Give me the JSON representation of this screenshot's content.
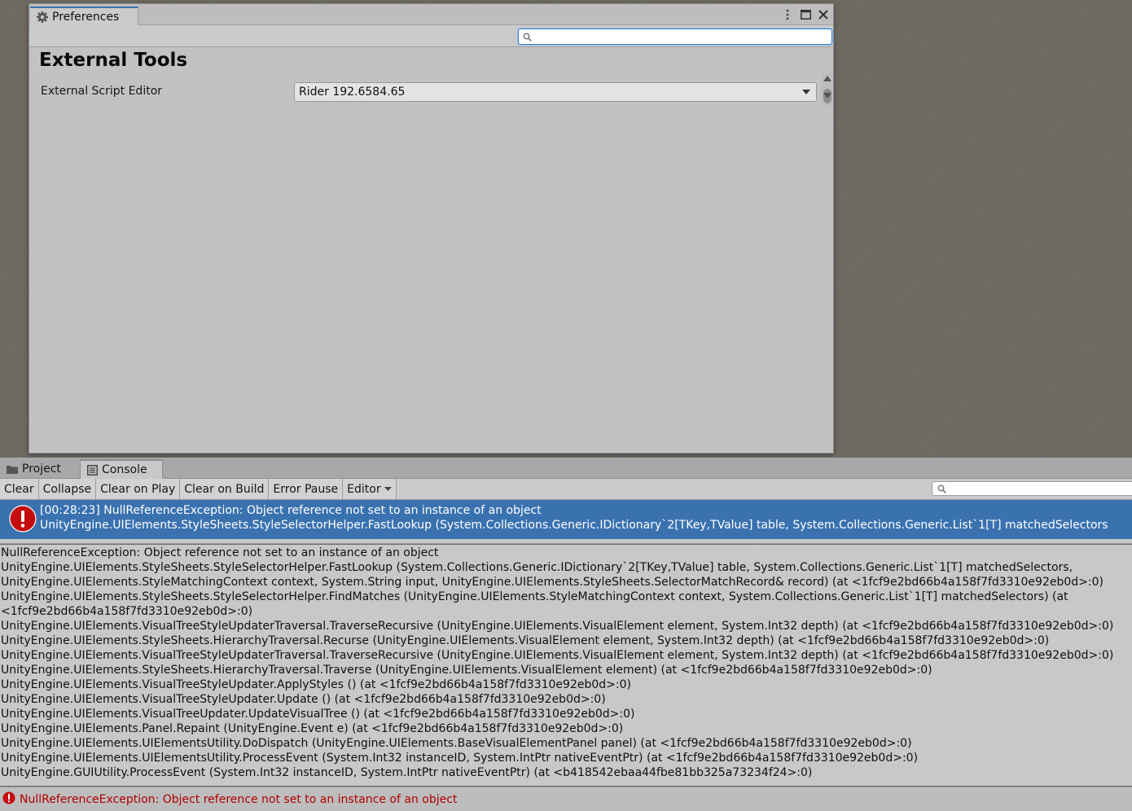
{
  "preferences": {
    "tab_label": "Preferences",
    "search_placeholder": "",
    "heading": "External Tools",
    "external_script_editor_label": "External Script Editor",
    "external_script_editor_value": "Rider 192.6584.65"
  },
  "bottom_panel": {
    "tabs": [
      {
        "label": "Project",
        "icon": "folder-icon"
      },
      {
        "label": "Console",
        "icon": "console-icon"
      }
    ]
  },
  "console_toolbar": {
    "clear": "Clear",
    "collapse": "Collapse",
    "clear_on_play": "Clear on Play",
    "clear_on_build": "Clear on Build",
    "error_pause": "Error Pause",
    "editor": "Editor",
    "search_placeholder": ""
  },
  "log_entry": {
    "line1": "[00:28:23] NullReferenceException: Object reference not set to an instance of an object",
    "line2": "UnityEngine.UIElements.StyleSheets.StyleSelectorHelper.FastLookup (System.Collections.Generic.IDictionary`2[TKey,TValue] table, System.Collections.Generic.List`1[T] matchedSelectors"
  },
  "details": [
    "NullReferenceException: Object reference not set to an instance of an object",
    "UnityEngine.UIElements.StyleSheets.StyleSelectorHelper.FastLookup (System.Collections.Generic.IDictionary`2[TKey,TValue] table, System.Collections.Generic.List`1[T] matchedSelectors,",
    "UnityEngine.UIElements.StyleMatchingContext context, System.String input, UnityEngine.UIElements.StyleSheets.SelectorMatchRecord& record) (at <1fcf9e2bd66b4a158f7fd3310e92eb0d>:0)",
    "UnityEngine.UIElements.StyleSheets.StyleSelectorHelper.FindMatches (UnityEngine.UIElements.StyleMatchingContext context, System.Collections.Generic.List`1[T] matchedSelectors) (at",
    "<1fcf9e2bd66b4a158f7fd3310e92eb0d>:0)",
    "UnityEngine.UIElements.VisualTreeStyleUpdaterTraversal.TraverseRecursive (UnityEngine.UIElements.VisualElement element, System.Int32 depth) (at <1fcf9e2bd66b4a158f7fd3310e92eb0d>:0)",
    "UnityEngine.UIElements.StyleSheets.HierarchyTraversal.Recurse (UnityEngine.UIElements.VisualElement element, System.Int32 depth) (at <1fcf9e2bd66b4a158f7fd3310e92eb0d>:0)",
    "UnityEngine.UIElements.VisualTreeStyleUpdaterTraversal.TraverseRecursive (UnityEngine.UIElements.VisualElement element, System.Int32 depth) (at <1fcf9e2bd66b4a158f7fd3310e92eb0d>:0)",
    "UnityEngine.UIElements.StyleSheets.HierarchyTraversal.Traverse (UnityEngine.UIElements.VisualElement element) (at <1fcf9e2bd66b4a158f7fd3310e92eb0d>:0)",
    "UnityEngine.UIElements.VisualTreeStyleUpdater.ApplyStyles () (at <1fcf9e2bd66b4a158f7fd3310e92eb0d>:0)",
    "UnityEngine.UIElements.VisualTreeStyleUpdater.Update () (at <1fcf9e2bd66b4a158f7fd3310e92eb0d>:0)",
    "UnityEngine.UIElements.VisualTreeUpdater.UpdateVisualTree () (at <1fcf9e2bd66b4a158f7fd3310e92eb0d>:0)",
    "UnityEngine.UIElements.Panel.Repaint (UnityEngine.Event e) (at <1fcf9e2bd66b4a158f7fd3310e92eb0d>:0)",
    "UnityEngine.UIElements.UIElementsUtility.DoDispatch (UnityEngine.UIElements.BaseVisualElementPanel panel) (at <1fcf9e2bd66b4a158f7fd3310e92eb0d>:0)",
    "UnityEngine.UIElements.UIElementsUtility.ProcessEvent (System.Int32 instanceID, System.IntPtr nativeEventPtr) (at <1fcf9e2bd66b4a158f7fd3310e92eb0d>:0)",
    "UnityEngine.GUIUtility.ProcessEvent (System.Int32 instanceID, System.IntPtr nativeEventPtr) (at <b418542ebaa44fbe81bb325a73234f24>:0)"
  ],
  "status_bar": {
    "text": "NullReferenceException: Object reference not set to an instance of an object"
  },
  "colors": {
    "selection": "#3a72b0",
    "error_red": "#c00000",
    "scene_background": "#6e6961"
  }
}
